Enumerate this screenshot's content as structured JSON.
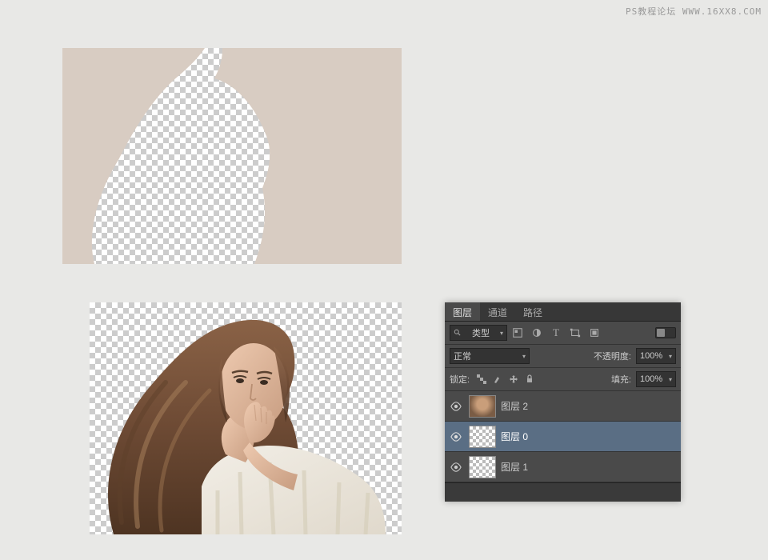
{
  "watermark": "PS教程论坛 WWW.16XX8.COM",
  "panel": {
    "tabs": {
      "layers": "图层",
      "channels": "通道",
      "paths": "路径"
    },
    "filter_label": "类型",
    "blend_mode": "正常",
    "opacity_label": "不透明度:",
    "opacity_value": "100%",
    "lock_label": "锁定:",
    "fill_label": "填充:",
    "fill_value": "100%",
    "layers": [
      {
        "name": "图层 2"
      },
      {
        "name": "图层 0"
      },
      {
        "name": "图层 1"
      }
    ]
  }
}
